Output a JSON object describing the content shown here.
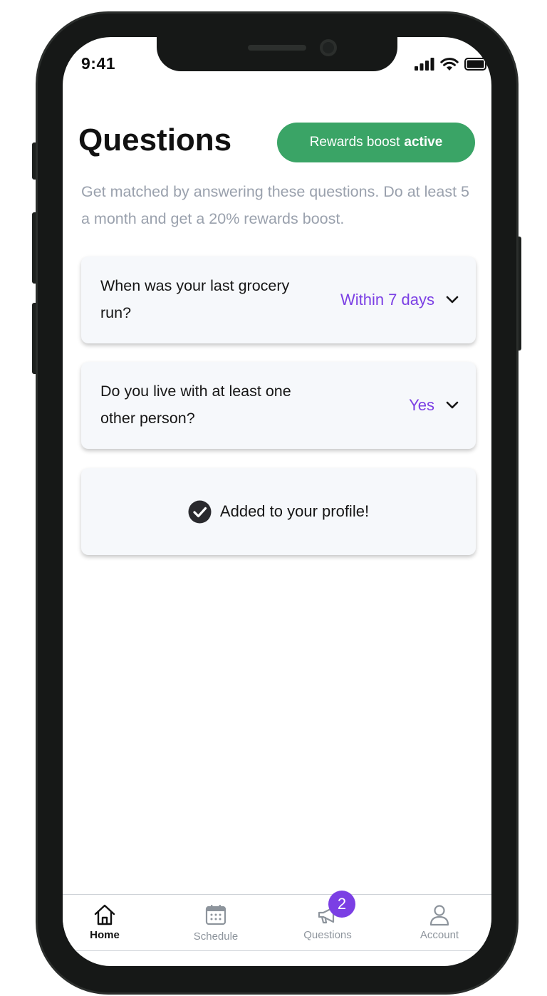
{
  "status_bar": {
    "time": "9:41"
  },
  "header": {
    "title": "Questions",
    "boost_prefix": "Rewards boost",
    "boost_status": "active"
  },
  "subtitle": "Get matched by answering these questions. Do at least 5 a month and get a 20% rewards boost.",
  "questions": [
    {
      "text": "When was your last grocery run?",
      "answer": "Within 7 days"
    },
    {
      "text": "Do you live with at least one other person?",
      "answer": "Yes"
    }
  ],
  "confirmation": {
    "text": "Added to your profile!"
  },
  "tabbar": {
    "home": "Home",
    "schedule": "Schedule",
    "questions": "Questions",
    "questions_badge": "2",
    "account": "Account"
  },
  "colors": {
    "boost_green": "#3aa466",
    "accent_purple": "#7b3fe4",
    "muted_text": "#9aa1ad",
    "card_bg": "#f6f8fb"
  }
}
